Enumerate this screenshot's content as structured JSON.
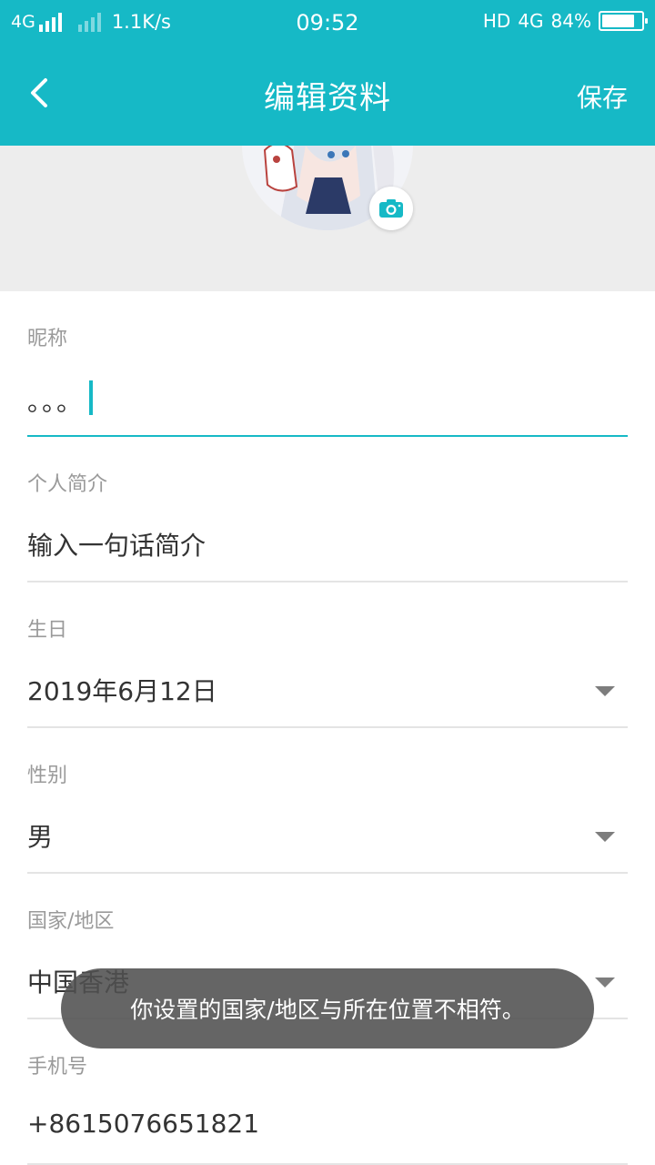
{
  "status_bar": {
    "network": "4G",
    "speed": "1.1K/s",
    "time": "09:52",
    "hd": "HD",
    "network_right": "4G",
    "battery": "84%",
    "battery_level": 0.84
  },
  "header": {
    "title": "编辑资料",
    "save_label": "保存"
  },
  "avatar": {
    "camera_icon": "camera-icon"
  },
  "form": {
    "nickname": {
      "label": "昵称",
      "value": "。。。"
    },
    "bio": {
      "label": "个人简介",
      "value": "输入一句话简介"
    },
    "birthday": {
      "label": "生日",
      "value": "2019年6月12日"
    },
    "gender": {
      "label": "性别",
      "value": "男"
    },
    "region": {
      "label": "国家/地区",
      "value": "中国香港"
    },
    "phone": {
      "label": "手机号",
      "value": "+8615076651821"
    }
  },
  "toast": {
    "text": "你设置的国家/地区与所在位置不相符。"
  },
  "colors": {
    "accent": "#16b9c6",
    "background_gray": "#ededed",
    "label_gray": "#9a9a9a",
    "divider": "#e4e4e4"
  }
}
